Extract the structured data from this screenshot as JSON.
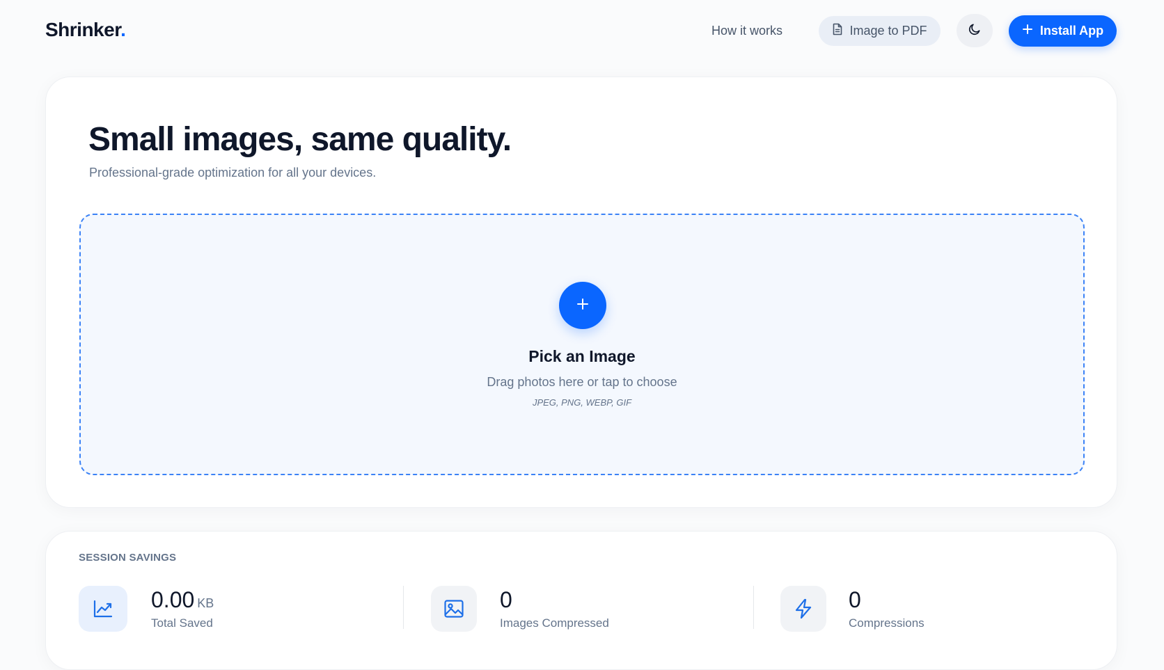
{
  "brand": {
    "name": "Shrinker",
    "dot": ".",
    "accent": "#0a66ff"
  },
  "nav": {
    "how_it_works": "How it works",
    "image_to_pdf": "Image to PDF",
    "image_to_pdf_icon": "document-icon",
    "theme_icon": "moon-icon",
    "install_label": "Install App",
    "install_icon": "plus-icon"
  },
  "hero": {
    "title": "Small images, same quality.",
    "subtitle": "Professional-grade optimization for all your devices."
  },
  "dropzone": {
    "icon": "plus-icon",
    "title": "Pick an Image",
    "subtitle": "Drag photos here or tap to choose",
    "formats": "JPEG, PNG, WEBP, GIF"
  },
  "stats": {
    "heading": "SESSION SAVINGS",
    "items": [
      {
        "icon": "trending-up-icon",
        "value": "0.00",
        "unit": "KB",
        "label": "Total Saved"
      },
      {
        "icon": "image-icon",
        "value": "0",
        "label": "Images Compressed"
      },
      {
        "icon": "lightning-icon",
        "value": "0",
        "label": "Compressions"
      }
    ]
  }
}
